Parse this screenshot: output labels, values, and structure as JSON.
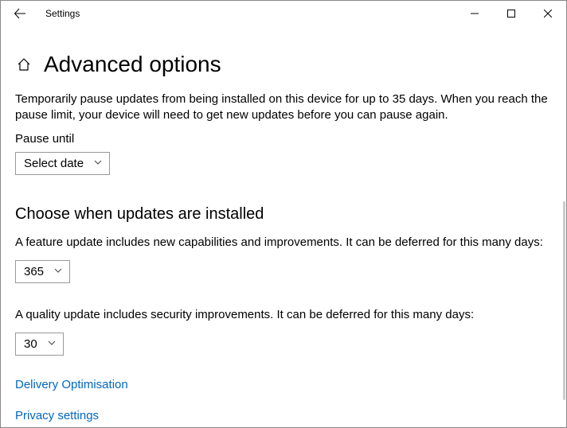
{
  "titlebar": {
    "title": "Settings"
  },
  "page": {
    "heading": "Advanced options",
    "pause_description": "Temporarily pause updates from being installed on this device for up to 35 days. When you reach the pause limit, your device will need to get new updates before you can pause again.",
    "pause_label": "Pause until",
    "pause_dropdown_value": "Select date",
    "section_heading": "Choose when updates are installed",
    "feature_update_text": "A feature update includes new capabilities and improvements. It can be deferred for this many days:",
    "feature_update_value": "365",
    "quality_update_text": "A quality update includes security improvements. It can be deferred for this many days:",
    "quality_update_value": "30",
    "link_delivery": "Delivery Optimisation",
    "link_privacy": "Privacy settings"
  }
}
